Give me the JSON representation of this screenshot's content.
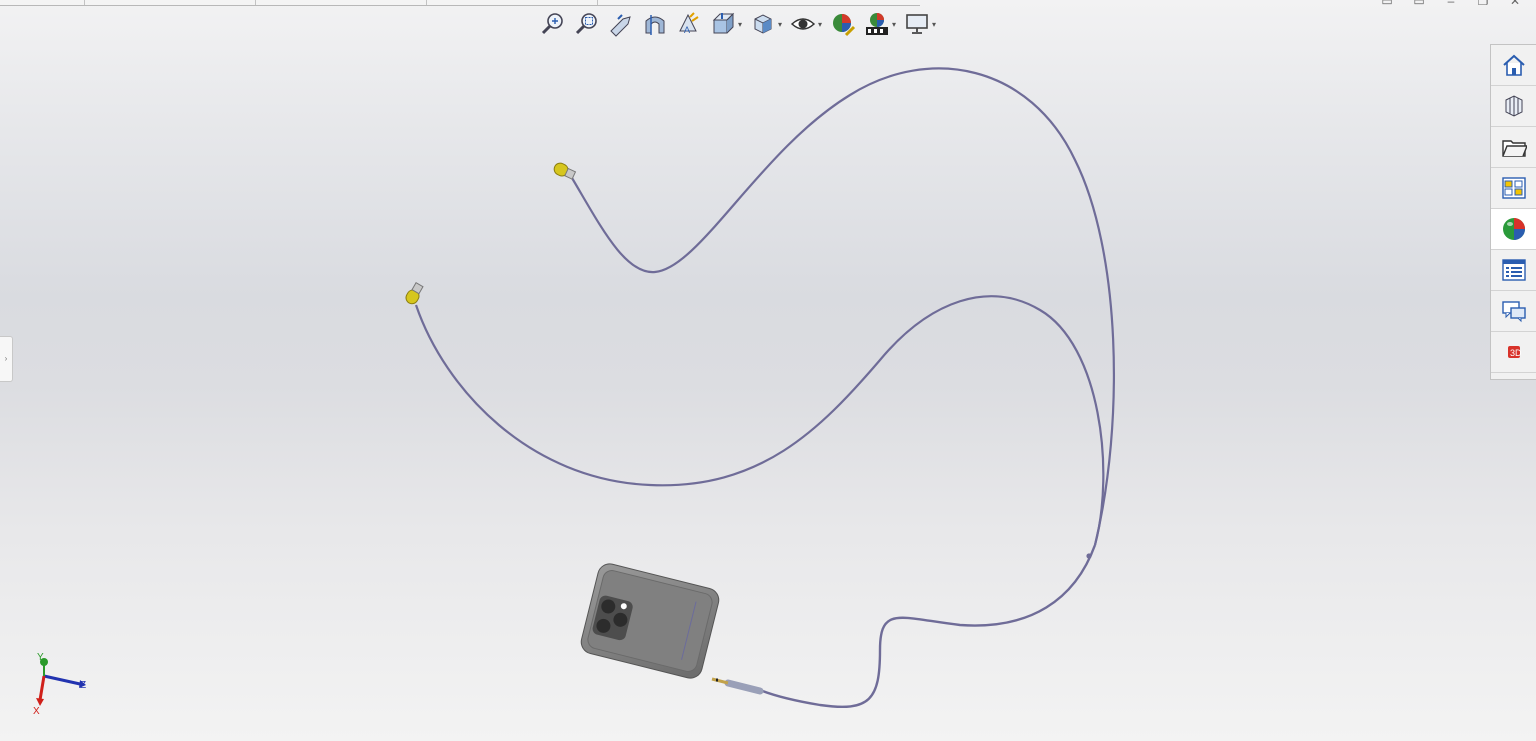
{
  "window_controls": [
    "restore-doc",
    "restore-doc-2",
    "minimize",
    "maximize",
    "close"
  ],
  "heads_up_toolbar": [
    {
      "icon": "zoom-to-fit-icon",
      "has_menu": false
    },
    {
      "icon": "zoom-to-area-icon",
      "has_menu": false
    },
    {
      "icon": "previous-view-icon",
      "has_menu": false
    },
    {
      "icon": "section-view-icon",
      "has_menu": false
    },
    {
      "icon": "dynamic-annotation-icon",
      "has_menu": false
    },
    {
      "icon": "view-orientation-icon",
      "has_menu": true
    },
    {
      "icon": "display-style-icon",
      "has_menu": true
    },
    {
      "icon": "hide-show-items-icon",
      "has_menu": true
    },
    {
      "icon": "edit-appearance-icon",
      "has_menu": false
    },
    {
      "icon": "apply-scene-icon",
      "has_menu": true
    },
    {
      "icon": "view-settings-icon",
      "has_menu": true
    }
  ],
  "task_pane": [
    {
      "icon": "home-icon",
      "active": false
    },
    {
      "icon": "3d-content-central-icon",
      "active": false
    },
    {
      "icon": "design-library-icon",
      "active": false
    },
    {
      "icon": "file-explorer-icon",
      "active": false
    },
    {
      "icon": "appearances-scenes-icon",
      "active": true
    },
    {
      "icon": "custom-properties-icon",
      "active": false
    },
    {
      "icon": "forum-icon",
      "active": false
    },
    {
      "icon": "solidworks-resources-icon",
      "active": false
    }
  ],
  "triad": {
    "x_label": "X",
    "y_label": "Y",
    "z_label": "Z"
  },
  "colors": {
    "cable": "#6f6c98",
    "earbud": "#d6c61e",
    "phone_body": "#7a7a7a",
    "triad_x": "#d0201a",
    "triad_y": "#2a9a2a",
    "triad_z": "#2233b0"
  }
}
